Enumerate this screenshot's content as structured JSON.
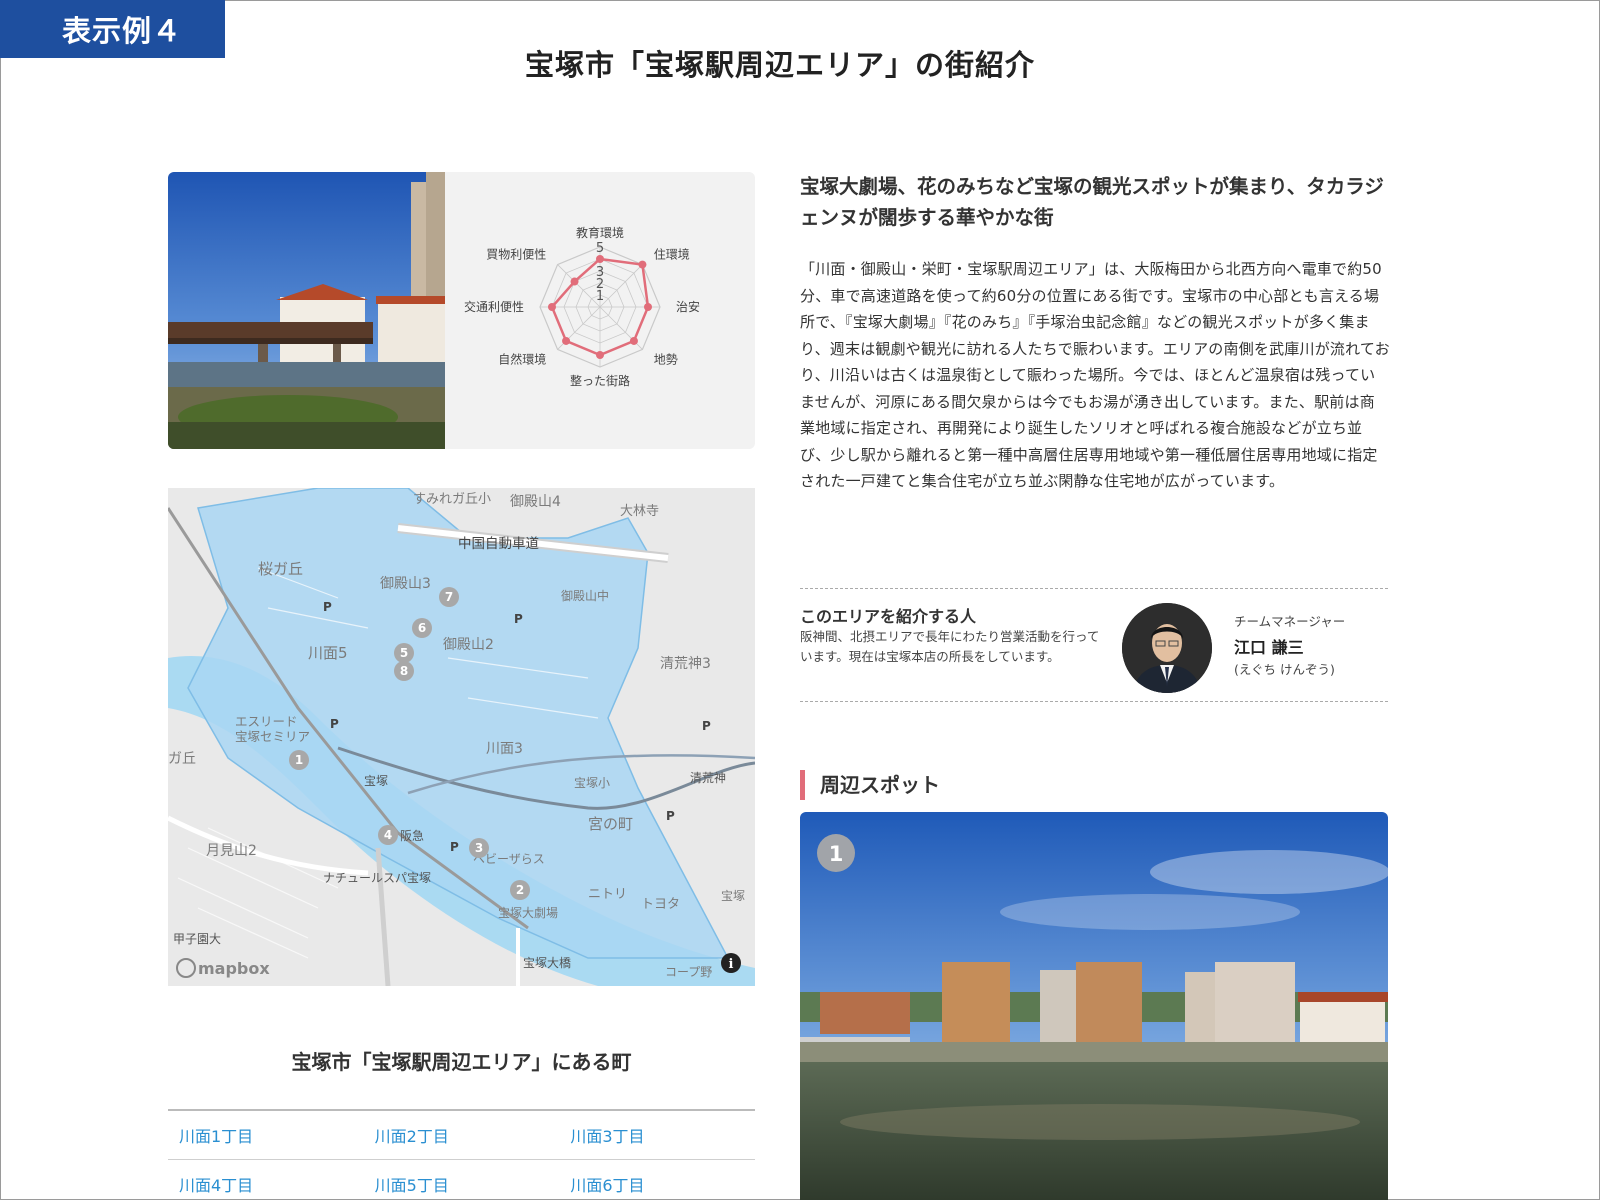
{
  "corner_tag": "表示例４",
  "page_title": "宝塚市「宝塚駅周辺エリア」の街紹介",
  "radar": {
    "axes": [
      "教育環境",
      "住環境",
      "治安",
      "地勢",
      "整った街路",
      "自然環境",
      "交通利便性",
      "買物利便性"
    ],
    "values": [
      4,
      5,
      4,
      4,
      4,
      4,
      4,
      3
    ],
    "scale_labels": [
      "5",
      "3",
      "2",
      "1"
    ],
    "color": "#e16d7a"
  },
  "map": {
    "labels": {
      "sumiregaoka": "すみれガ丘小",
      "goten4": "御殿山4",
      "dairinji": "大林寺",
      "chugoku": "中国自動車道",
      "sakuragaoka": "桜ガ丘",
      "goten3": "御殿山3",
      "gotenchu": "御殿山中",
      "kawamo5": "川面5",
      "goten2": "御殿山2",
      "seikojin3": "清荒神3",
      "esreed": "エスリード\n宝塚セミリア",
      "gaoka": "ガ丘",
      "kawamo3": "川面3",
      "takarazuka": "宝塚",
      "takarazuka_sho": "宝塚小",
      "seikojin": "清荒神",
      "miyanomachi": "宮の町",
      "hankyu": "阪急",
      "babyzaras": "ベビーザらス",
      "tsukimiyama": "月見山2",
      "natural": "ナチュールスパ宝塚",
      "nitori": "ニトリ",
      "toyota": "トヨタ",
      "daigekijo": "宝塚大劇場",
      "koshien": "甲子園大",
      "ohashi": "宝塚大橋",
      "coop": "コープ野",
      "takarazuka_right": "宝塚",
      "logo": "mapbox"
    },
    "markers": [
      "1",
      "2",
      "3",
      "4",
      "5",
      "6",
      "7",
      "8"
    ],
    "parking": [
      "P",
      "P",
      "P",
      "P",
      "P",
      "P",
      "P",
      "P"
    ],
    "info_icon": "i"
  },
  "towns": {
    "title": "宝塚市「宝塚駅周辺エリア」にある町",
    "rows": [
      [
        "川面1丁目",
        "川面2丁目",
        "川面3丁目"
      ],
      [
        "川面4丁目",
        "川面5丁目",
        "川面6丁目"
      ]
    ]
  },
  "catch_copy": "宝塚大劇場、花のみちなど宝塚の観光スポットが集まり、タカラジェンヌが闊歩する華やかな街",
  "intro": "「川面・御殿山・栄町・宝塚駅周辺エリア」は、大阪梅田から北西方向へ電車で約50分、車で高速道路を使って約60分の位置にある街です。宝塚市の中心部とも言える場所で、『宝塚大劇場』『花のみち』『手塚治虫記念館』などの観光スポットが多く集まり、週末は観劇や観光に訪れる人たちで賑わいます。エリアの南側を武庫川が流れており、川沿いは古くは温泉街として賑わった場所。今では、ほとんど温泉宿は残っていませんが、河原にある間欠泉からは今でもお湯が湧き出しています。また、駅前は商業地域に指定され、再開発により誕生したソリオと呼ばれる複合施設などが立ち並び、少し駅から離れると第一種中高層住居専用地域や第一種低層住居専用地域に指定された一戸建てと集合住宅が立ち並ぶ閑静な住宅地が広がっています。",
  "person": {
    "heading": "このエリアを紹介する人",
    "desc": "阪神間、北摂エリアで長年にわたり営業活動を行っています。現在は宝塚本店の所長をしています。",
    "role": "チームマネージャー",
    "name": "江口 謙三",
    "kana": "(えぐち けんぞう)"
  },
  "spots": {
    "heading": "周辺スポット",
    "badge": "1"
  },
  "colors": {
    "brand_blue": "#1e4f9f",
    "accent_pink": "#e16d7a",
    "link_blue": "#2a8fd1",
    "map_area": "#a9d6f3"
  }
}
